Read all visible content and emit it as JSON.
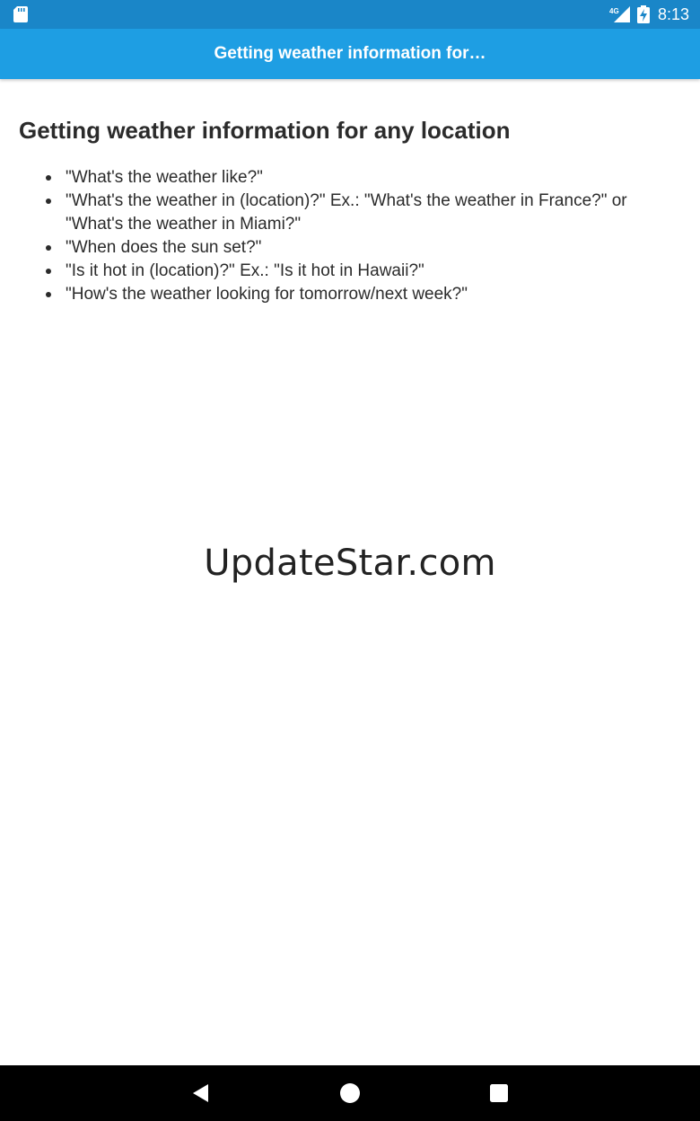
{
  "status_bar": {
    "network": "4G",
    "time": "8:13",
    "icons": [
      "sd-card-icon",
      "signal-icon",
      "battery-charging-icon"
    ]
  },
  "app_bar": {
    "title": "Getting weather information for…"
  },
  "content": {
    "heading": "Getting weather information for any location",
    "examples": [
      "\"What's the weather like?\"",
      "\"What's the weather in (location)?\" Ex.: \"What's the weather in France?\" or \"What's the weather in Miami?\"",
      "\"When does the sun set?\"",
      "\"Is it hot in (location)?\" Ex.: \"Is it hot in Hawaii?\"",
      "\"How's the weather looking for tomorrow/next week?\""
    ]
  },
  "watermark": "UpdateStar.com",
  "nav_bar": {
    "icons": [
      "back-icon",
      "home-icon",
      "recents-icon"
    ]
  },
  "colors": {
    "status_bar": "#1a86c8",
    "app_bar": "#1e9ee3",
    "text": "#2b2b2b",
    "nav_bar": "#000000"
  }
}
